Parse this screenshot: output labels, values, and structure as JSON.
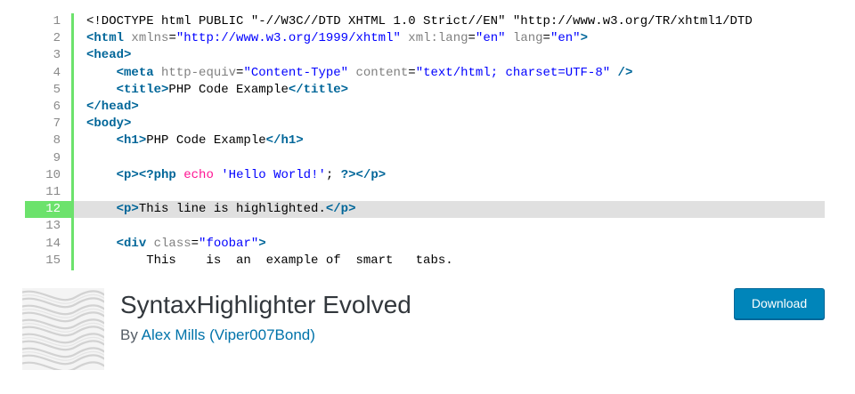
{
  "code_lines": [
    {
      "n": "1",
      "hl": false,
      "parts": [
        [
          "plain",
          "<!DOCTYPE html PUBLIC \"-//W3C//DTD XHTML 1.0 Strict//EN\" \"http://www.w3.org/TR/xhtml1/DTD"
        ]
      ]
    },
    {
      "n": "2",
      "hl": false,
      "parts": [
        [
          "tag",
          "<html"
        ],
        [
          "plain",
          " "
        ],
        [
          "attr",
          "xmlns"
        ],
        [
          "plain",
          "="
        ],
        [
          "str",
          "\"http://www.w3.org/1999/xhtml\""
        ],
        [
          "plain",
          " "
        ],
        [
          "attr",
          "xml:lang"
        ],
        [
          "plain",
          "="
        ],
        [
          "str",
          "\"en\""
        ],
        [
          "plain",
          " "
        ],
        [
          "attr",
          "lang"
        ],
        [
          "plain",
          "="
        ],
        [
          "str",
          "\"en\""
        ],
        [
          "tag",
          ">"
        ]
      ]
    },
    {
      "n": "3",
      "hl": false,
      "parts": [
        [
          "tag",
          "<head>"
        ]
      ]
    },
    {
      "n": "4",
      "hl": false,
      "parts": [
        [
          "plain",
          "    "
        ],
        [
          "tag",
          "<meta"
        ],
        [
          "plain",
          " "
        ],
        [
          "attr",
          "http-equiv"
        ],
        [
          "plain",
          "="
        ],
        [
          "str",
          "\"Content-Type\""
        ],
        [
          "plain",
          " "
        ],
        [
          "attr",
          "content"
        ],
        [
          "plain",
          "="
        ],
        [
          "str",
          "\"text/html; charset=UTF-8\""
        ],
        [
          "plain",
          " "
        ],
        [
          "tag",
          "/>"
        ]
      ]
    },
    {
      "n": "5",
      "hl": false,
      "parts": [
        [
          "plain",
          "    "
        ],
        [
          "tag",
          "<title>"
        ],
        [
          "plain",
          "PHP Code Example"
        ],
        [
          "tag",
          "</title>"
        ]
      ]
    },
    {
      "n": "6",
      "hl": false,
      "parts": [
        [
          "tag",
          "</head>"
        ]
      ]
    },
    {
      "n": "7",
      "hl": false,
      "parts": [
        [
          "tag",
          "<body>"
        ]
      ]
    },
    {
      "n": "8",
      "hl": false,
      "parts": [
        [
          "plain",
          "    "
        ],
        [
          "tag",
          "<h1>"
        ],
        [
          "plain",
          "PHP Code Example"
        ],
        [
          "tag",
          "</h1>"
        ]
      ]
    },
    {
      "n": "9",
      "hl": false,
      "parts": []
    },
    {
      "n": "10",
      "hl": false,
      "parts": [
        [
          "plain",
          "    "
        ],
        [
          "tag",
          "<p>"
        ],
        [
          "tag",
          "<?php"
        ],
        [
          "plain",
          " "
        ],
        [
          "kw",
          "echo"
        ],
        [
          "plain",
          " "
        ],
        [
          "str",
          "'Hello World!'"
        ],
        [
          "plain",
          "; "
        ],
        [
          "tag",
          "?>"
        ],
        [
          "tag",
          "</p>"
        ]
      ]
    },
    {
      "n": "11",
      "hl": false,
      "parts": []
    },
    {
      "n": "12",
      "hl": true,
      "parts": [
        [
          "plain",
          "    "
        ],
        [
          "tag",
          "<p>"
        ],
        [
          "plain",
          "This line is highlighted."
        ],
        [
          "tag",
          "</p>"
        ]
      ]
    },
    {
      "n": "13",
      "hl": false,
      "parts": []
    },
    {
      "n": "14",
      "hl": false,
      "parts": [
        [
          "plain",
          "    "
        ],
        [
          "tag",
          "<div"
        ],
        [
          "plain",
          " "
        ],
        [
          "attr",
          "class"
        ],
        [
          "plain",
          "="
        ],
        [
          "str",
          "\"foobar\""
        ],
        [
          "tag",
          ">"
        ]
      ]
    },
    {
      "n": "15",
      "hl": false,
      "parts": [
        [
          "plain",
          "        This    is  an  example of  smart   tabs."
        ]
      ]
    }
  ],
  "plugin": {
    "title": "SyntaxHighlighter Evolved",
    "by_label": "By ",
    "author": "Alex Mills (Viper007Bond)",
    "download_label": "Download"
  },
  "colors": {
    "gutter_accent": "#6ce26c",
    "highlight_row": "#e0e0e0",
    "tag": "#006699",
    "attribute": "#808080",
    "string": "#0000ff",
    "keyword": "#ff1493",
    "button": "#0085ba",
    "link": "#0073aa"
  },
  "icons": {
    "plugin_icon": "wavy-lines-pattern-icon"
  }
}
